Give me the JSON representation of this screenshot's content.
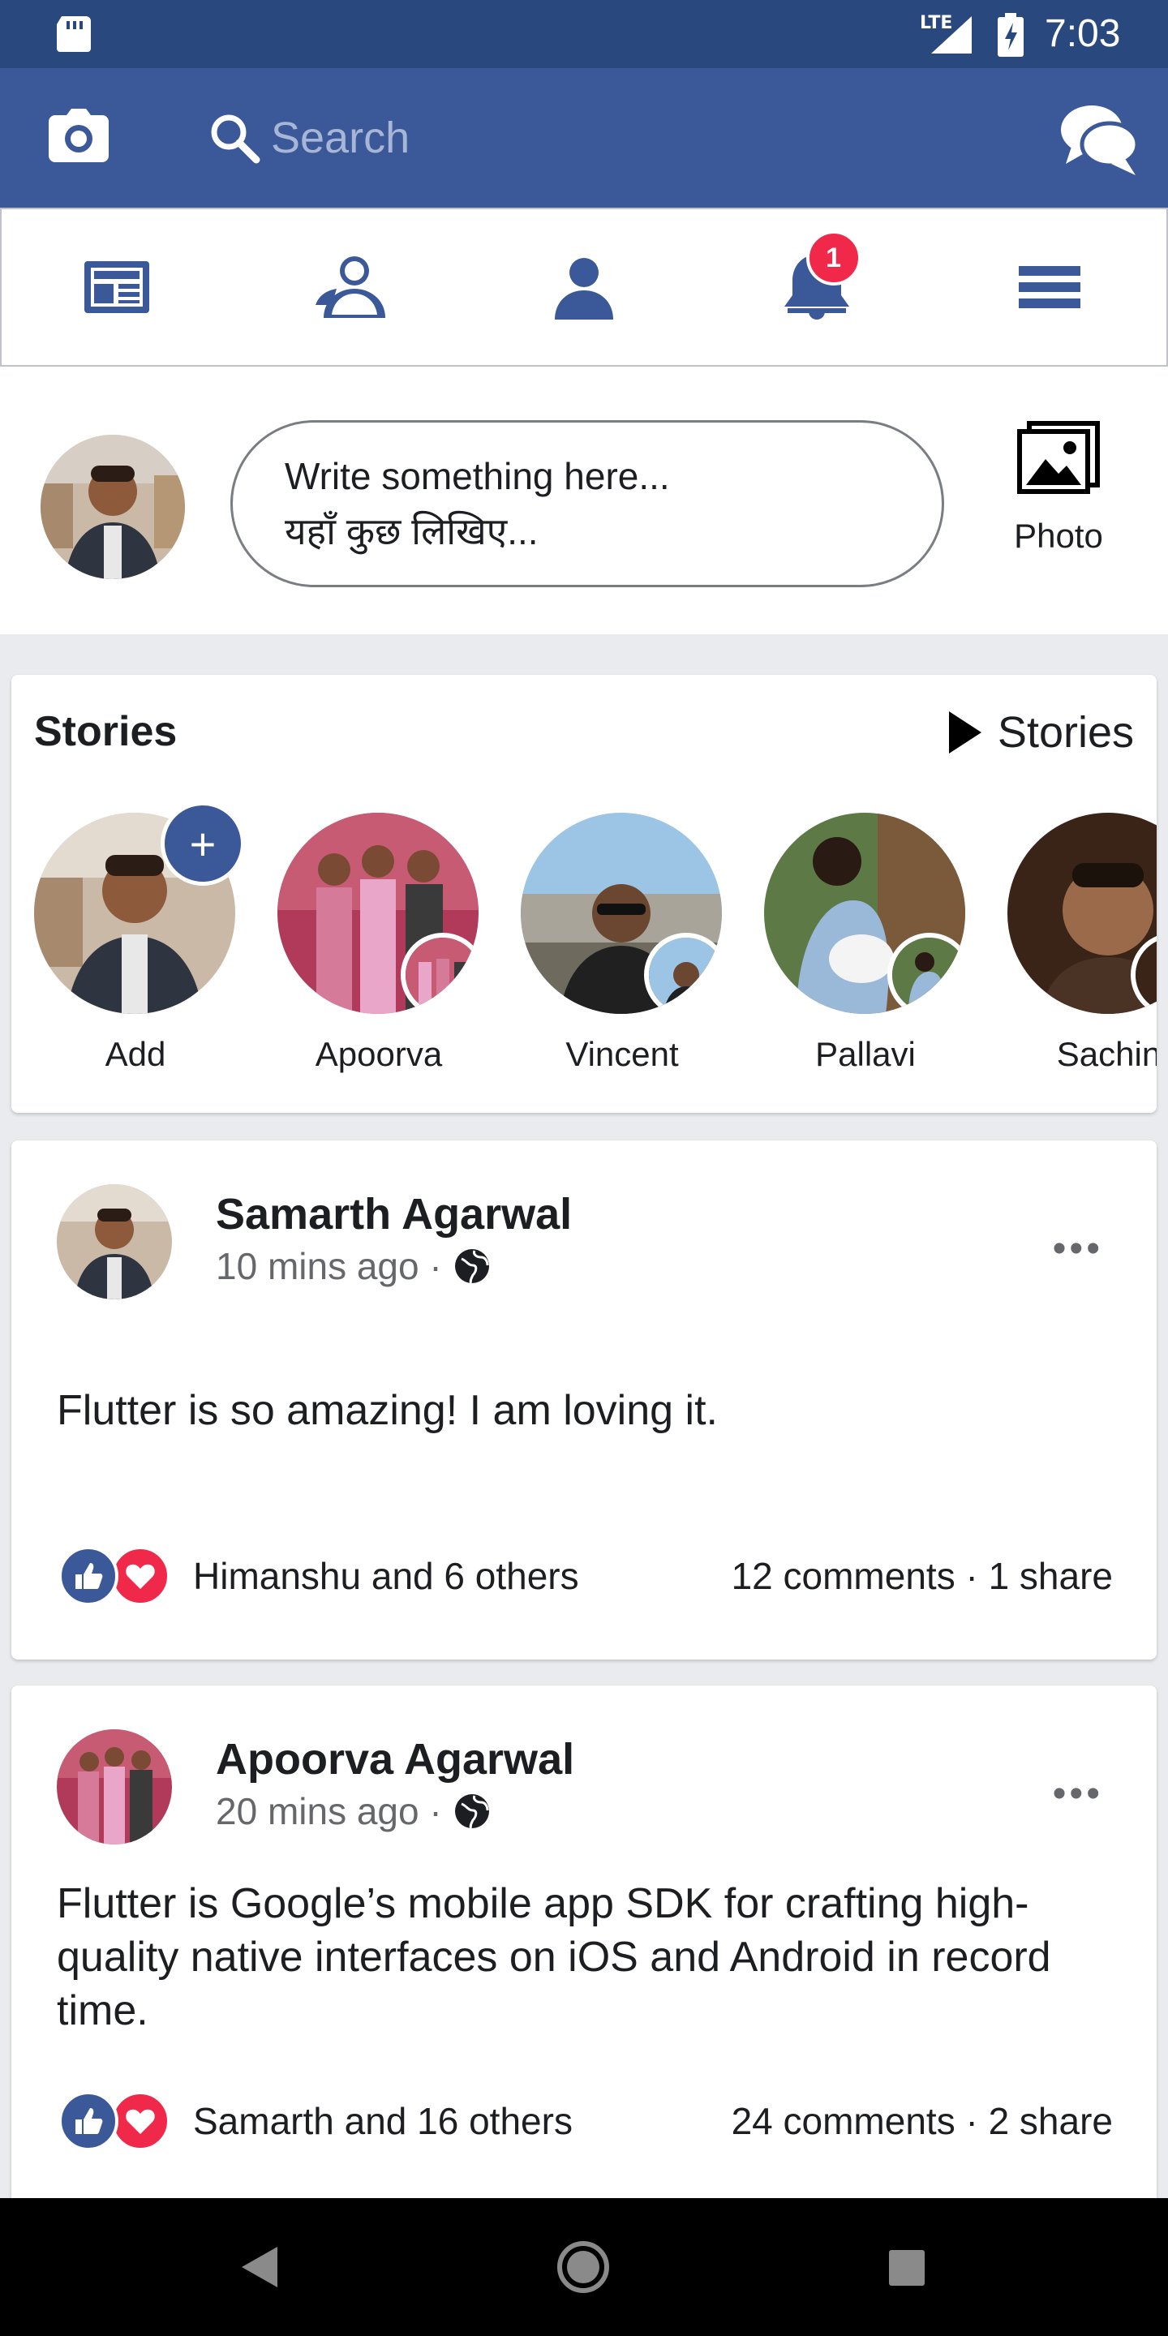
{
  "status_bar": {
    "network": "LTE",
    "time": "7:03"
  },
  "app_bar": {
    "search_placeholder": "Search"
  },
  "nav_tabs": [
    {
      "id": "news-feed",
      "icon": "newspaper-icon"
    },
    {
      "id": "friends",
      "icon": "friends-icon"
    },
    {
      "id": "profile",
      "icon": "person-icon"
    },
    {
      "id": "notifications",
      "icon": "bell-icon",
      "badge": "1"
    },
    {
      "id": "menu",
      "icon": "hamburger-icon"
    }
  ],
  "composer": {
    "placeholder_line1": "Write something here...",
    "placeholder_line2": "यहाँ कुछ लिखिए...",
    "photo_label": "Photo"
  },
  "stories": {
    "title": "Stories",
    "see_all": "Stories",
    "items": [
      {
        "name": "Add"
      },
      {
        "name": "Apoorva"
      },
      {
        "name": "Vincent"
      },
      {
        "name": "Pallavi"
      },
      {
        "name": "Sachin"
      }
    ]
  },
  "posts": [
    {
      "author": "Samarth Agarwal",
      "time": "10 mins ago ·",
      "text": "Flutter is so amazing! I am loving it.",
      "reactions": "Himanshu and 6 others",
      "counts": "12 comments · 1 share"
    },
    {
      "author": "Apoorva Agarwal",
      "time": "20 mins ago ·",
      "text": "Flutter is Google’s mobile app SDK for crafting high-quality native interfaces on iOS and Android in record time.",
      "reactions": "Samarth and 16 others",
      "counts": "24 comments · 2 share"
    }
  ],
  "colors": {
    "brand": "#3b5998",
    "status_bar": "#29487d",
    "badge": "#f02849",
    "love": "#f0284a"
  }
}
